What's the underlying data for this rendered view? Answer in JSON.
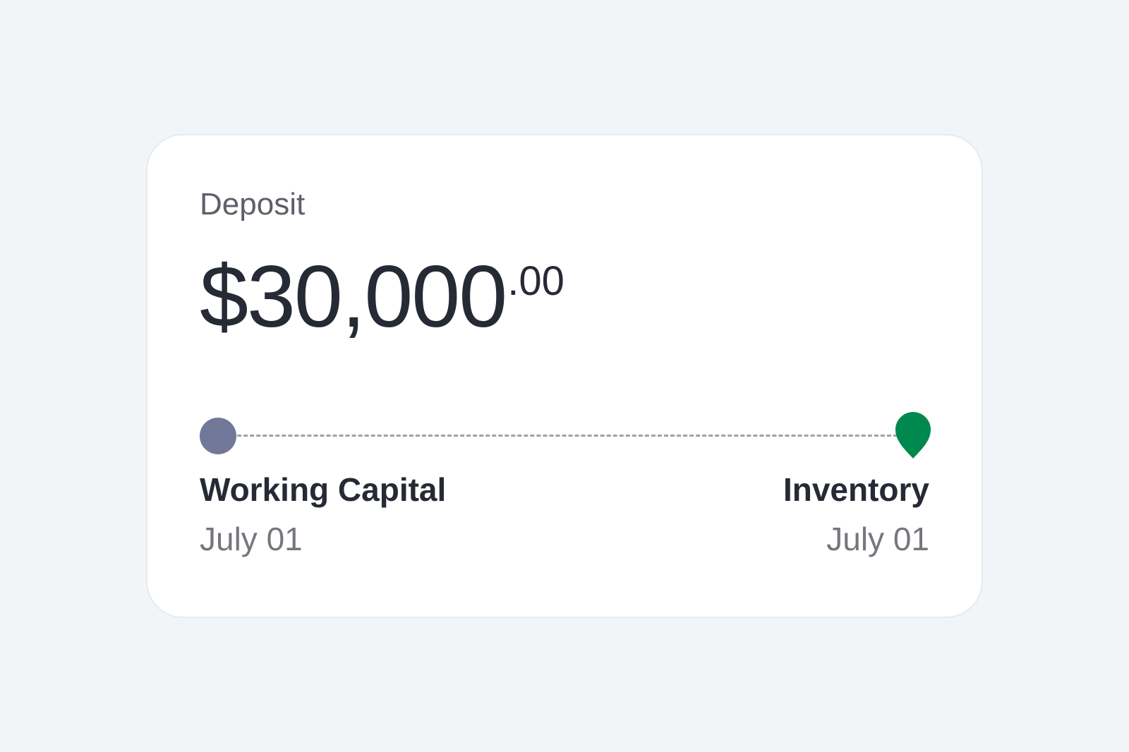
{
  "card": {
    "label": "Deposit",
    "amount": {
      "main": "$30,000",
      "decimal_point": ".",
      "cents": "00"
    },
    "route": {
      "start": {
        "title": "Working Capital",
        "date": "July 01"
      },
      "end": {
        "title": "Inventory",
        "date": "July 01"
      }
    }
  },
  "colors": {
    "background": "#f1f5f8",
    "card": "#ffffff",
    "text_primary": "#262a35",
    "text_secondary": "#74777d",
    "start_marker": "#727899",
    "end_marker": "#00894f",
    "dashed_line": "#9fa2a7"
  },
  "icons": {
    "start": "start-dot-icon",
    "end": "location-pin-icon"
  }
}
